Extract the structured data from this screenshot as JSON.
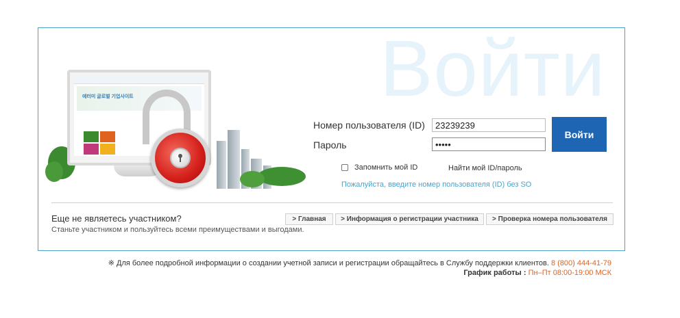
{
  "watermark": "Войти",
  "illustration": {
    "screen_banner_text": "에터미 글로벌 기업사이트"
  },
  "form": {
    "user_id_label": "Номер пользователя (ID)",
    "user_id_value": "23239239",
    "password_label": "Пароль",
    "password_value": "•••••",
    "login_button": "Войти",
    "remember_label": "Запомнить мой ID",
    "find_link": "Найти мой ID/пароль",
    "hint": "Пожалуйста, введите номер пользователя (ID) без SO"
  },
  "signup": {
    "question": "Еще не являетесь участником?",
    "subtext": "Станьте участником и пользуйтесь всеми преимуществами и выгодами.",
    "buttons": [
      "> Главная",
      "> Информация о регистрации участника",
      "> Проверка номера пользователя"
    ]
  },
  "footer": {
    "info_text": "※ Для более подробной информации о создании учетной записи и регистрации обращайтесь в Службу поддержки клиентов.",
    "phone": "8 (800) 444-41-79",
    "schedule_label": "График работы :",
    "schedule_hours": "Пн–Пт 08:00-19:00 МСК"
  },
  "colors": {
    "accent": "#1e66b3",
    "border": "#4aa3c9",
    "hint": "#4aa3c9",
    "phone": "#e0621f"
  }
}
